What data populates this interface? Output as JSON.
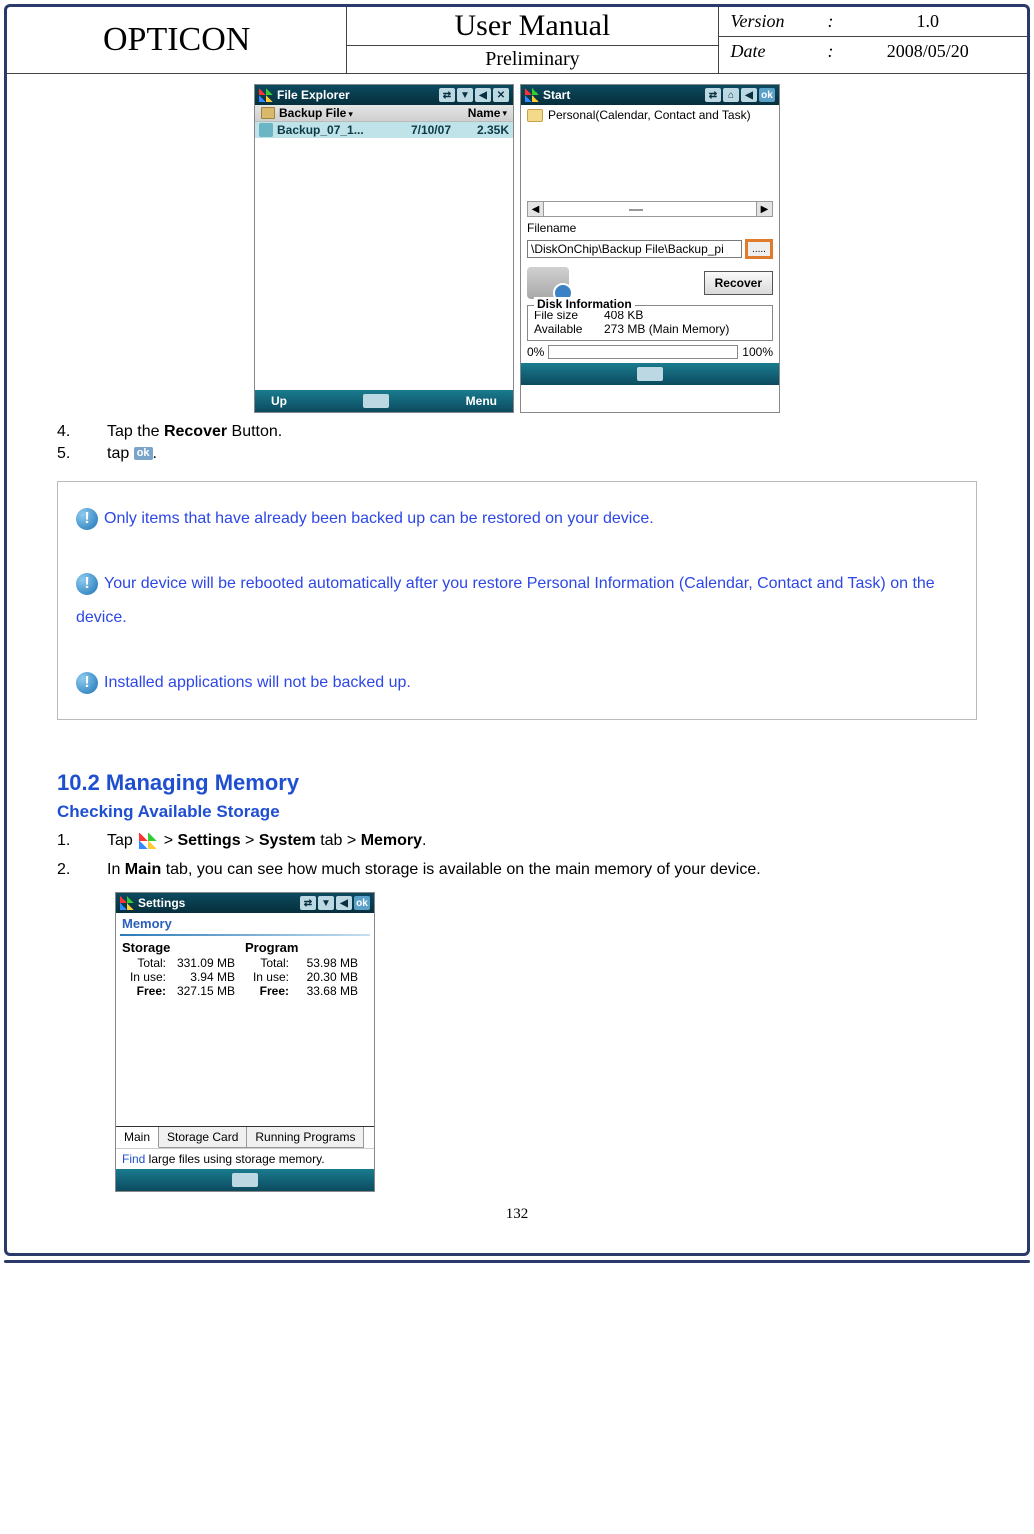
{
  "header": {
    "brand": "OPTICON",
    "title": "User Manual",
    "subtitle": "Preliminary",
    "version_label": "Version",
    "version_value": "1.0",
    "date_label": "Date",
    "date_value": "2008/05/20",
    "colon": ":"
  },
  "page_number": "132",
  "device_left": {
    "title": "File Explorer",
    "sub_left": "Backup File",
    "sub_right": "Name",
    "file_name": "Backup_07_1...",
    "file_date": "7/10/07",
    "file_size": "2.35K",
    "soft_left": "Up",
    "soft_right": "Menu",
    "close_glyph": "✕",
    "top_icons": {
      "a": "⇄",
      "b": "▼",
      "c": "◀"
    }
  },
  "device_right": {
    "title": "Start",
    "pim_label": "Personal(Calendar, Contact and Task)",
    "filename_label": "Filename",
    "filename_value": "\\DiskOnChip\\Backup File\\Backup_pi",
    "browse_label": ".....",
    "recover_btn": "Recover",
    "disk_info_label": "Disk Information",
    "file_size_label": "File size",
    "file_size_value": "408 KB",
    "available_label": "Available",
    "available_value": "273 MB (Main Memory)",
    "progress_left": "0%",
    "progress_right": "100%",
    "ok_label": "ok",
    "top_icons": {
      "a": "⇄",
      "b": "⌂",
      "c": "◀"
    },
    "scroll": {
      "left": "◀",
      "right": "▶",
      "thumb": "▮"
    }
  },
  "steps_a": {
    "s4_num": "4.",
    "s4_text_a": "Tap the ",
    "s4_bold": "Recover",
    "s4_text_b": " Button.",
    "s5_num": "5.",
    "s5_text_a": "tap ",
    "s5_ok": "ok",
    "s5_text_b": "."
  },
  "notes": {
    "bang": "!",
    "n1": "Only items that have already been backed up can be restored on your device.",
    "n2": "Your device will be rebooted automatically after you restore Personal Information (Calendar, Contact and Task) on the device.",
    "n3": "Installed applications will not be backed up."
  },
  "section": {
    "heading": "10.2 Managing Memory",
    "subheading": "Checking Available Storage",
    "s1_num": "1.",
    "s1_a": "Tap ",
    "s1_b": " > ",
    "s1_settings": "Settings",
    "s1_c": " > ",
    "s1_system": "System",
    "s1_d": " tab > ",
    "s1_memory": "Memory",
    "s1_e": ".",
    "s2_num": "2.",
    "s2_a": "In ",
    "s2_main": "Main",
    "s2_b": " tab, you can see how much storage is available on the main memory of your device."
  },
  "memory_device": {
    "title": "Settings",
    "page_title": "Memory",
    "ok_label": "ok",
    "top_icons": {
      "a": "⇄",
      "b": "▼",
      "c": "◀"
    },
    "col1_head": "Storage",
    "col2_head": "Program",
    "rows": {
      "total_label": "Total:",
      "inuse_label": "In use:",
      "free_label": "Free:",
      "s_total": "331.09 MB",
      "s_inuse": "3.94 MB",
      "s_free": "327.15 MB",
      "p_total": "53.98 MB",
      "p_inuse": "20.30 MB",
      "p_free": "33.68 MB"
    },
    "tabs": {
      "main": "Main",
      "card": "Storage Card",
      "prog": "Running Programs"
    },
    "hint_link": "Find",
    "hint_rest": " large files using storage memory."
  }
}
